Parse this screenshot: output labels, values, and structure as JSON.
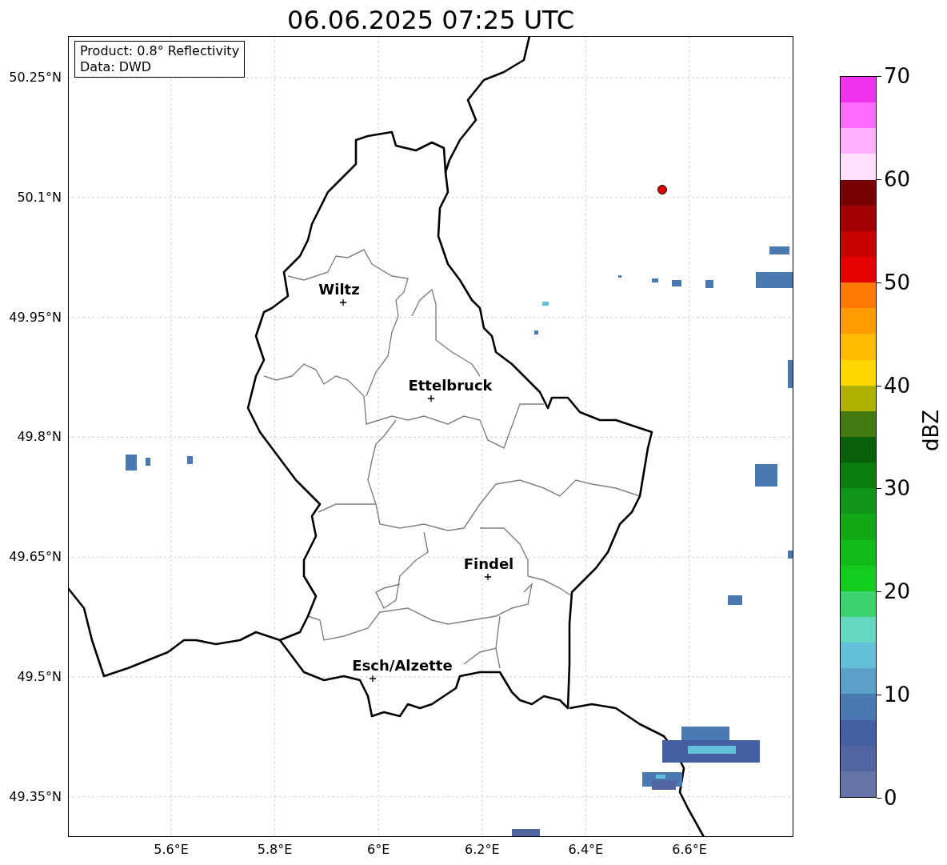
{
  "title": "06.06.2025 07:25 UTC",
  "info_box": [
    "Product: 0.8° Reflectivity",
    "Data: DWD"
  ],
  "lat_ticks": [
    "50.25°N",
    "50.1°N",
    "49.95°N",
    "49.8°N",
    "49.65°N",
    "49.5°N",
    "49.35°N"
  ],
  "lon_ticks": [
    "5.6°E",
    "5.8°E",
    "6°E",
    "6.2°E",
    "6.4°E",
    "6.6°E"
  ],
  "cities": [
    {
      "name": "Wiltz"
    },
    {
      "name": "Ettelbruck"
    },
    {
      "name": "Findel"
    },
    {
      "name": "Esch/Alzette"
    }
  ],
  "colorbar": {
    "label": "dBZ",
    "ticks": [
      "70",
      "60",
      "50",
      "40",
      "30",
      "20",
      "10",
      "0"
    ],
    "bands": [
      {
        "color": "#ee33ee"
      },
      {
        "color": "#ff6cff"
      },
      {
        "color": "#ffb0ff"
      },
      {
        "color": "#ffe0ff"
      },
      {
        "color": "#780000"
      },
      {
        "color": "#a00000"
      },
      {
        "color": "#c80000"
      },
      {
        "color": "#e60000"
      },
      {
        "color": "#ff7a00"
      },
      {
        "color": "#ff9c00"
      },
      {
        "color": "#ffbb00"
      },
      {
        "color": "#ffd700"
      },
      {
        "color": "#b0b000"
      },
      {
        "color": "#447810"
      },
      {
        "color": "#0a600a"
      },
      {
        "color": "#0c7e10"
      },
      {
        "color": "#0f9418"
      },
      {
        "color": "#10a814"
      },
      {
        "color": "#12bc18"
      },
      {
        "color": "#14cc1e"
      },
      {
        "color": "#3cd46e"
      },
      {
        "color": "#64d8c0"
      },
      {
        "color": "#64c0d8"
      },
      {
        "color": "#5aa0c8"
      },
      {
        "color": "#4a78b0"
      },
      {
        "color": "#4560a2"
      },
      {
        "color": "#5166a0"
      },
      {
        "color": "#6474a6"
      }
    ]
  }
}
